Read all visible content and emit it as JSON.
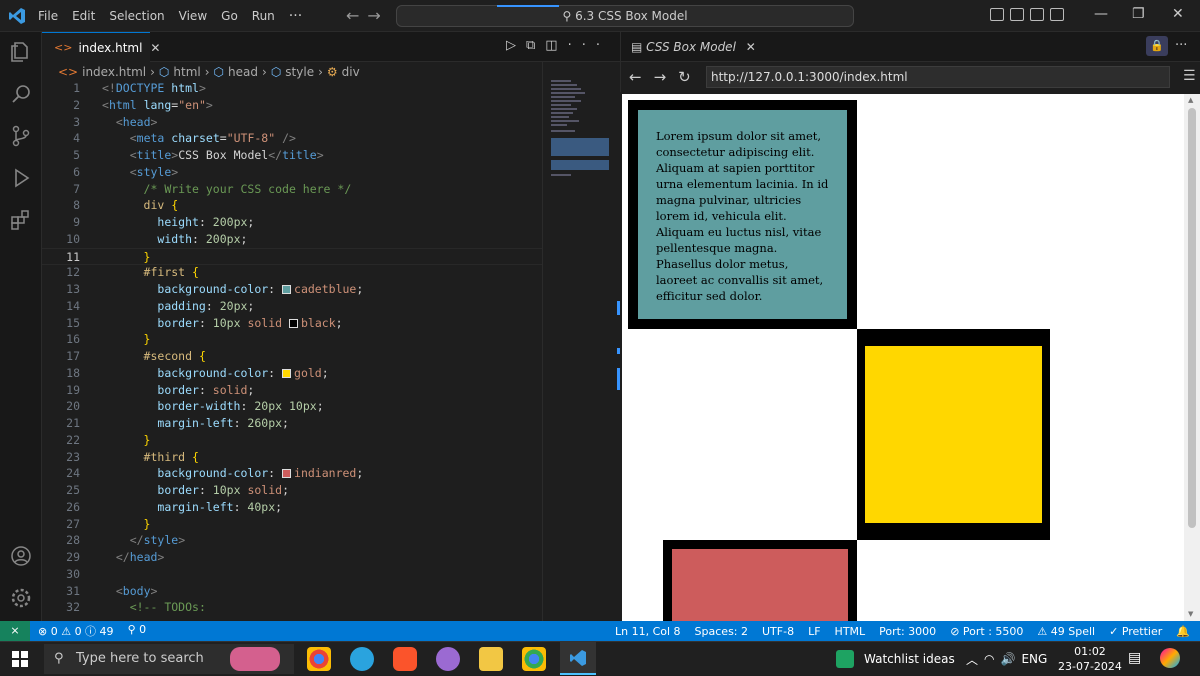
{
  "titlebar": {
    "menu": [
      "File",
      "Edit",
      "Selection",
      "View",
      "Go",
      "Run",
      "···"
    ],
    "search_text": "6.3 CSS Box Model"
  },
  "editor": {
    "tab_label": "index.html",
    "breadcrumb": [
      "index.html",
      "html",
      "head",
      "style",
      "div"
    ],
    "active_line": 11
  },
  "preview": {
    "tab_label": "CSS Box Model",
    "url": "http://127.0.0.1:3000/index.html",
    "paragraph": "Lorem ipsum dolor sit amet, consectetur adipiscing elit. Aliquam at sapien porttitor urna elementum lacinia. In id magna pulvinar, ultricies lorem id, vehicula elit. Aliquam eu luctus nisl, vitae pellentesque magna. Phasellus dolor metus, laoreet ac convallis sit amet, efficitur sed dolor."
  },
  "colors": {
    "first_box": "#5f9ea0",
    "second_box": "#ffd700",
    "third_box": "#cd5c5c",
    "statusbar": "#0078d4"
  },
  "statusbar": {
    "problems": "⊗ 0 ⚠ 0 ⓘ 49",
    "ports": "⚲ 0",
    "position": "Ln 11, Col 8",
    "spaces": "Spaces: 2",
    "encoding": "UTF-8",
    "eol": "LF",
    "language": "HTML",
    "port": "Port: 3000",
    "live_port": "⊘ Port : 5500",
    "spell": "⚠ 49 Spell",
    "prettier": "✓ Prettier"
  },
  "taskbar": {
    "search_placeholder": "Type here to search",
    "watchlist": "Watchlist ideas",
    "lang": "ENG",
    "time": "01:02",
    "date": "23-07-2024"
  },
  "code_lines": [
    {
      "n": "1",
      "html": "<span class='t-br'>&lt;!</span><span class='t-tag'>DOCTYPE</span> <span class='t-attr'>html</span><span class='t-br'>&gt;</span>"
    },
    {
      "n": "2",
      "html": "<span class='t-br'>&lt;</span><span class='t-tag'>html</span> <span class='t-attr'>lang</span><span class='t-punc'>=</span><span class='t-str'>\"en\"</span><span class='t-br'>&gt;</span>"
    },
    {
      "n": "3",
      "html": "  <span class='t-br'>&lt;</span><span class='t-tag'>head</span><span class='t-br'>&gt;</span>"
    },
    {
      "n": "4",
      "html": "    <span class='t-br'>&lt;</span><span class='t-tag'>meta</span> <span class='t-attr'>charset</span><span class='t-punc'>=</span><span class='t-str'>\"UTF-8\"</span> <span class='t-br'>/&gt;</span>"
    },
    {
      "n": "5",
      "html": "    <span class='t-br'>&lt;</span><span class='t-tag'>title</span><span class='t-br'>&gt;</span><span class='t-txt'>CSS Box Model</span><span class='t-br'>&lt;/</span><span class='t-tag'>title</span><span class='t-br'>&gt;</span>"
    },
    {
      "n": "6",
      "html": "    <span class='t-br'>&lt;</span><span class='t-tag'>style</span><span class='t-br'>&gt;</span>"
    },
    {
      "n": "7",
      "html": "      <span class='t-com'>/* Write your CSS code here */</span>"
    },
    {
      "n": "8",
      "html": "      <span class='t-sel'>div</span> <span class='t-brace'>{</span>"
    },
    {
      "n": "9",
      "html": "        <span class='t-prop'>height</span><span class='t-punc'>: </span><span class='t-num'>200px</span><span class='t-punc'>;</span>"
    },
    {
      "n": "10",
      "html": "        <span class='t-prop'>width</span><span class='t-punc'>: </span><span class='t-num'>200px</span><span class='t-punc'>;</span>"
    },
    {
      "n": "11",
      "html": "      <span class='t-brace'>}</span>"
    },
    {
      "n": "12",
      "html": "      <span class='t-sel'>#first</span> <span class='t-brace'>{</span>"
    },
    {
      "n": "13",
      "html": "        <span class='t-prop'>background-color</span><span class='t-punc'>: </span><span class='sw' style='background:cadetblue'></span><span class='t-val'>cadetblue</span><span class='t-punc'>;</span>"
    },
    {
      "n": "14",
      "html": "        <span class='t-prop'>padding</span><span class='t-punc'>: </span><span class='t-num'>20px</span><span class='t-punc'>;</span>"
    },
    {
      "n": "15",
      "html": "        <span class='t-prop'>border</span><span class='t-punc'>: </span><span class='t-num'>10px</span> <span class='t-val'>solid</span> <span class='sw' style='background:#000'></span><span class='t-val'>black</span><span class='t-punc'>;</span>"
    },
    {
      "n": "16",
      "html": "      <span class='t-brace'>}</span>"
    },
    {
      "n": "17",
      "html": "      <span class='t-sel'>#second</span> <span class='t-brace'>{</span>"
    },
    {
      "n": "18",
      "html": "        <span class='t-prop'>background-color</span><span class='t-punc'>: </span><span class='sw' style='background:gold'></span><span class='t-val'>gold</span><span class='t-punc'>;</span>"
    },
    {
      "n": "19",
      "html": "        <span class='t-prop'>border</span><span class='t-punc'>: </span><span class='t-val'>solid</span><span class='t-punc'>;</span>"
    },
    {
      "n": "20",
      "html": "        <span class='t-prop'>border-width</span><span class='t-punc'>: </span><span class='t-num'>20px</span> <span class='t-num'>10px</span><span class='t-punc'>;</span>"
    },
    {
      "n": "21",
      "html": "        <span class='t-prop'>margin-left</span><span class='t-punc'>: </span><span class='t-num'>260px</span><span class='t-punc'>;</span>"
    },
    {
      "n": "22",
      "html": "      <span class='t-brace'>}</span>"
    },
    {
      "n": "23",
      "html": "      <span class='t-sel'>#third</span> <span class='t-brace'>{</span>"
    },
    {
      "n": "24",
      "html": "        <span class='t-prop'>background-color</span><span class='t-punc'>: </span><span class='sw' style='background:indianred'></span><span class='t-val'>indianred</span><span class='t-punc'>;</span>"
    },
    {
      "n": "25",
      "html": "        <span class='t-prop'>border</span><span class='t-punc'>: </span><span class='t-num'>10px</span> <span class='t-val'>solid</span><span class='t-punc'>;</span>"
    },
    {
      "n": "26",
      "html": "        <span class='t-prop'>margin-left</span><span class='t-punc'>: </span><span class='t-num'>40px</span><span class='t-punc'>;</span>"
    },
    {
      "n": "27",
      "html": "      <span class='t-brace'>}</span>"
    },
    {
      "n": "28",
      "html": "    <span class='t-br'>&lt;/</span><span class='t-tag'>style</span><span class='t-br'>&gt;</span>"
    },
    {
      "n": "29",
      "html": "  <span class='t-br'>&lt;/</span><span class='t-tag'>head</span><span class='t-br'>&gt;</span>"
    },
    {
      "n": "30",
      "html": ""
    },
    {
      "n": "31",
      "html": "  <span class='t-br'>&lt;</span><span class='t-tag'>body</span><span class='t-br'>&gt;</span>"
    },
    {
      "n": "32",
      "html": "    <span class='t-com'>&lt;!-- TODOs:</span>"
    }
  ]
}
